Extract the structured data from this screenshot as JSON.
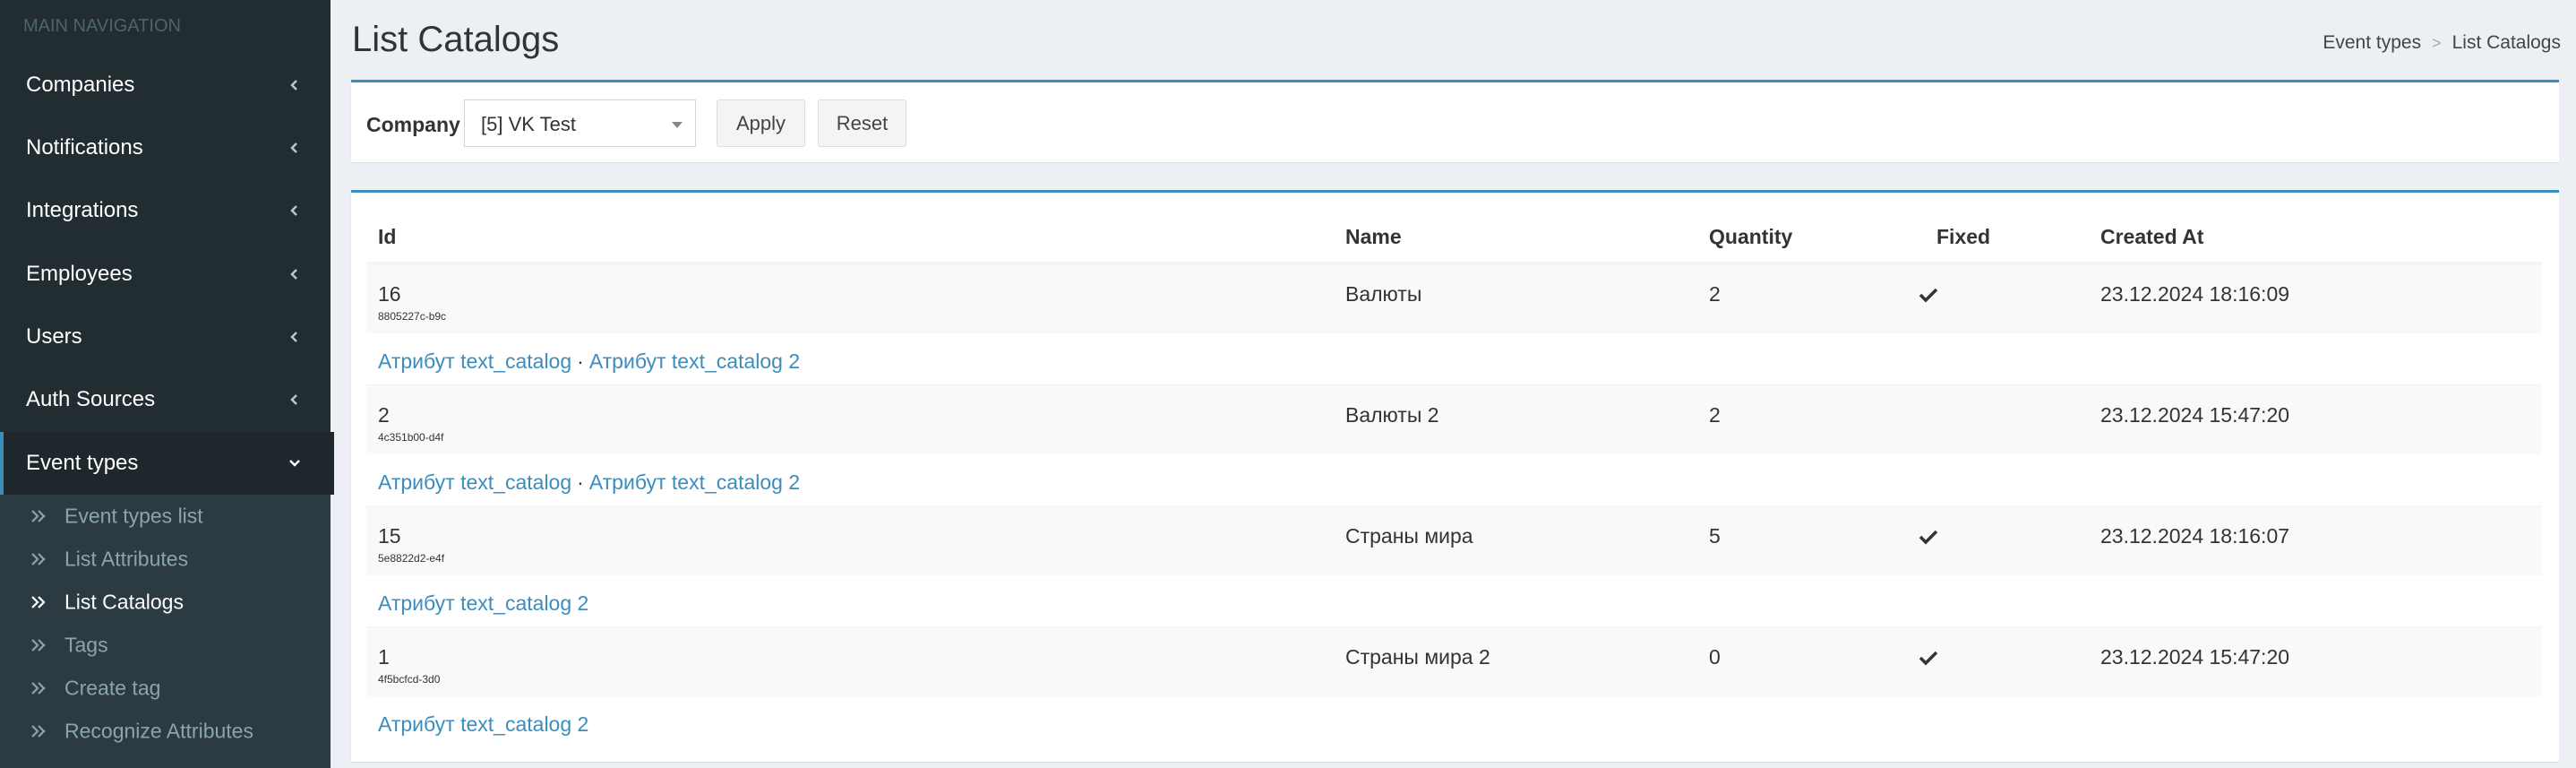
{
  "sidebar": {
    "header": "MAIN NAVIGATION",
    "items": [
      {
        "label": "Companies"
      },
      {
        "label": "Notifications"
      },
      {
        "label": "Integrations"
      },
      {
        "label": "Employees"
      },
      {
        "label": "Users"
      },
      {
        "label": "Auth Sources"
      },
      {
        "label": "Event types"
      }
    ],
    "submenu": [
      {
        "label": "Event types list"
      },
      {
        "label": "List Attributes"
      },
      {
        "label": "List Catalogs"
      },
      {
        "label": "Tags"
      },
      {
        "label": "Create tag"
      },
      {
        "label": "Recognize Attributes"
      }
    ]
  },
  "page": {
    "title": "List Catalogs",
    "breadcrumb": [
      "Event types",
      "List Catalogs"
    ]
  },
  "filter": {
    "label": "Company",
    "selected": "[5] VK Test",
    "apply_label": "Apply",
    "reset_label": "Reset"
  },
  "table": {
    "headers": [
      "Id",
      "Name",
      "Quantity",
      "Fixed",
      "Created At"
    ],
    "rows": [
      {
        "id": "16",
        "uid": "8805227c-b9c",
        "name": "Валюты",
        "quantity": "2",
        "fixed": true,
        "created": "23.12.2024 18:16:09",
        "attributes": [
          "Атрибут text_catalog",
          "Атрибут text_catalog 2"
        ]
      },
      {
        "id": "2",
        "uid": "4c351b00-d4f",
        "name": "Валюты 2",
        "quantity": "2",
        "fixed": false,
        "created": "23.12.2024 15:47:20",
        "attributes": [
          "Атрибут text_catalog",
          "Атрибут text_catalog 2"
        ]
      },
      {
        "id": "15",
        "uid": "5e8822d2-e4f",
        "name": "Страны мира",
        "quantity": "5",
        "fixed": true,
        "created": "23.12.2024 18:16:07",
        "attributes": [
          "Атрибут text_catalog 2"
        ]
      },
      {
        "id": "1",
        "uid": "4f5bcfcd-3d0",
        "name": "Страны мира 2",
        "quantity": "0",
        "fixed": true,
        "created": "23.12.2024 15:47:20",
        "attributes": [
          "Атрибут text_catalog 2"
        ]
      }
    ],
    "separator": "·"
  },
  "colors": {
    "sidebar_bg": "#222d32",
    "submenu_bg": "#2c3b41",
    "accent": "#3c8dbc",
    "content_bg": "#ecf0f5"
  },
  "icons": {
    "menu_collapsed": "chevron-left-icon",
    "menu_expanded": "chevron-down-icon",
    "submenu_item": "double-chevron-right-icon",
    "fixed": "check-icon",
    "select": "caret-down-icon"
  }
}
